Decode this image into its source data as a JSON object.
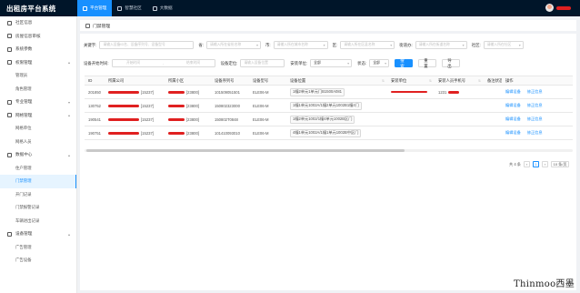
{
  "app": {
    "title": "出租房平台系统"
  },
  "topnav": [
    {
      "label": "平台管理",
      "icon": "grid-icon",
      "active": true
    },
    {
      "label": "智慧社区",
      "icon": "community-icon",
      "active": false
    },
    {
      "label": "大数据",
      "icon": "chart-icon",
      "active": false
    }
  ],
  "sidebar": {
    "items": [
      {
        "label": "社区信息",
        "type": "item"
      },
      {
        "label": "房屋信息审核",
        "type": "item"
      },
      {
        "label": "系统参数",
        "type": "item"
      },
      {
        "label": "权限管理",
        "type": "group",
        "chevron": "▴"
      },
      {
        "label": "管理员",
        "type": "sub"
      },
      {
        "label": "角色管理",
        "type": "sub"
      },
      {
        "label": "专业管理",
        "type": "item",
        "chevron": "▾"
      },
      {
        "label": "网格管理",
        "type": "group",
        "chevron": "▴"
      },
      {
        "label": "网格单位",
        "type": "sub"
      },
      {
        "label": "网格人员",
        "type": "sub"
      },
      {
        "label": "数据中心",
        "type": "group",
        "chevron": "▴"
      },
      {
        "label": "住户管理",
        "type": "sub"
      },
      {
        "label": "门禁管理",
        "type": "sub",
        "active": true
      },
      {
        "label": "开门记录",
        "type": "sub"
      },
      {
        "label": "门禁报警记录",
        "type": "sub"
      },
      {
        "label": "车辆进出记录",
        "type": "sub"
      },
      {
        "label": "设备管理",
        "type": "group",
        "chevron": "▴"
      },
      {
        "label": "广告管理",
        "type": "sub"
      },
      {
        "label": "广告设备",
        "type": "sub"
      }
    ]
  },
  "tab": {
    "label": "门禁管理"
  },
  "filters": {
    "row1": [
      {
        "label": "关键字:",
        "placeholder": "请输入设备ID名、设备序列号、设备型号"
      },
      {
        "label": "省:",
        "placeholder": "请输入所在省份名称"
      },
      {
        "label": "市:",
        "placeholder": "请输入所在城市名称"
      },
      {
        "label": "区:",
        "placeholder": "请输入所在区县名称"
      },
      {
        "label": "街道办:",
        "placeholder": "请输入所在街道名称"
      },
      {
        "label": "社区:",
        "placeholder": "请输入所在社区"
      }
    ],
    "row2": {
      "date_label": "设备开始时间:",
      "date_start": "开始时间",
      "date_sep": "-",
      "date_end": "结束时间",
      "position_label": "设备定位:",
      "position_placeholder": "请输入设备位置",
      "unit_label": "安装单位:",
      "unit_value": "全部",
      "state_label": "状态:",
      "state_value": "全部",
      "search_btn": "搜索",
      "reset_btn": "重置",
      "export_btn": "导出"
    }
  },
  "table": {
    "headers": [
      "ID",
      "所属公司",
      "所属小区",
      "设备序列号",
      "设备型号",
      "设备位置",
      "安装单位",
      "安装人员手机号",
      "备注状态",
      "操作"
    ],
    "rows": [
      {
        "id": "201850",
        "company_suffix": "[15237]",
        "family_suffix": "[23800]",
        "serial": "101509051501",
        "model": "ELE06-M",
        "position": "1幢2单元1单元门B1500A081",
        "unit_redacted": true,
        "phone": "1231",
        "actions": [
          "编辑设备",
          "修正信息"
        ]
      },
      {
        "id": "130752",
        "company_suffix": "[15237]",
        "family_suffix": "[23800]",
        "serial": "150802323000",
        "model": "ELE06-M",
        "position": "1幢1单元1002A/1幢2单元1002B1幢4门",
        "unit_redacted": false,
        "phone": "",
        "actions": [
          "编辑设备",
          "修正信息"
        ]
      },
      {
        "id": "190541",
        "company_suffix": "[15237]",
        "family_suffix": "[23800]",
        "serial": "150802T0848",
        "model": "ELE06-M",
        "position": "1幢2单元1002/1幢4单元1002B区门",
        "unit_redacted": false,
        "phone": "",
        "actions": [
          "编辑设备",
          "修正信息"
        ]
      },
      {
        "id": "190751",
        "company_suffix": "[15237]",
        "family_suffix": "[23800]",
        "serial": "101410093010",
        "model": "ELE06-M",
        "position": "4幢1单元1002A/1幢1单元1002B中区门",
        "unit_redacted": false,
        "phone": "",
        "actions": [
          "编辑设备",
          "修正信息"
        ]
      }
    ]
  },
  "pagination": {
    "total": "共 4 条",
    "page": "1",
    "size": "10 条/页"
  },
  "watermark": "Thinmoo西墨",
  "colors": {
    "topbar": "#001529",
    "primary": "#1890ff",
    "redact": "#e02020"
  }
}
